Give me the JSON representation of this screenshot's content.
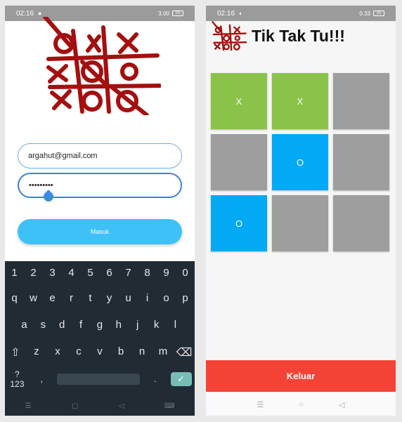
{
  "left_phone": {
    "status": {
      "time": "02:16",
      "indicator": "●",
      "network": "3.00",
      "battery": "25"
    },
    "email_value": "argahut@gmail.com",
    "password_value": "•••••••••",
    "login_button": "Masuk",
    "keyboard": {
      "row1": [
        "1",
        "2",
        "3",
        "4",
        "5",
        "6",
        "7",
        "8",
        "9",
        "0"
      ],
      "row2": [
        "q",
        "w",
        "e",
        "r",
        "t",
        "y",
        "u",
        "i",
        "o",
        "p"
      ],
      "row3": [
        "a",
        "s",
        "d",
        "f",
        "g",
        "h",
        "j",
        "k",
        "l"
      ],
      "row4": [
        "⇧",
        "z",
        "x",
        "c",
        "v",
        "b",
        "n",
        "m",
        "⌫"
      ],
      "numbers_key": "?123",
      "comma_key": ",",
      "period_key": ".",
      "enter_key": "✓"
    },
    "nav": [
      "☰",
      "▢",
      "◁",
      "⌨"
    ]
  },
  "right_phone": {
    "status": {
      "time": "02:16",
      "indicator": "◐",
      "network": "0.33",
      "battery": "25"
    },
    "title": "Tik Tak Tu!!!",
    "board": [
      {
        "value": "X",
        "color": "#8bc34a"
      },
      {
        "value": "X",
        "color": "#8bc34a"
      },
      {
        "value": "",
        "color": "#9e9e9e"
      },
      {
        "value": "",
        "color": "#9e9e9e"
      },
      {
        "value": "O",
        "color": "#03a9f4"
      },
      {
        "value": "",
        "color": "#9e9e9e"
      },
      {
        "value": "O",
        "color": "#03a9f4"
      },
      {
        "value": "",
        "color": "#9e9e9e"
      },
      {
        "value": "",
        "color": "#9e9e9e"
      }
    ],
    "exit_button": "Keluar",
    "nav": [
      "☰",
      "○",
      "◁"
    ]
  }
}
